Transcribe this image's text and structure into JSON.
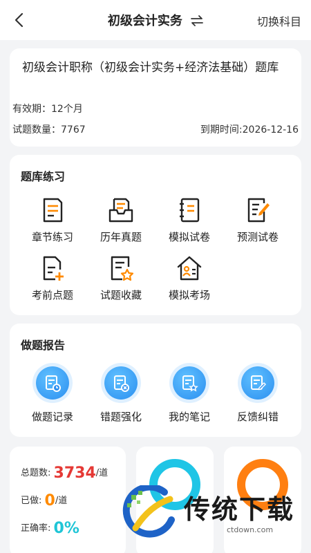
{
  "header": {
    "title": "初级会计实务",
    "switch_label": "切换科目",
    "icons": [
      "back-icon",
      "swap-icon"
    ]
  },
  "bank": {
    "title": "初级会计职称（初级会计实务+经济法基础）题库",
    "validity": "有效期：12个月",
    "question_count": "试题数量：7767",
    "expire": "到期时间:2026-12-16"
  },
  "practice": {
    "title": "题库练习",
    "items": [
      {
        "label": "章节练习",
        "icon": "chapter-icon"
      },
      {
        "label": "历年真题",
        "icon": "past-exam-icon"
      },
      {
        "label": "模拟试卷",
        "icon": "mock-paper-icon"
      },
      {
        "label": "预测试卷",
        "icon": "forecast-paper-icon"
      },
      {
        "label": "考前点题",
        "icon": "pre-exam-icon"
      },
      {
        "label": "试题收藏",
        "icon": "favorite-icon"
      },
      {
        "label": "模拟考场",
        "icon": "exam-room-icon"
      }
    ]
  },
  "report": {
    "title": "做题报告",
    "items": [
      {
        "label": "做题记录",
        "icon": "record-icon"
      },
      {
        "label": "错题强化",
        "icon": "wrong-question-icon"
      },
      {
        "label": "我的笔记",
        "icon": "notes-icon"
      },
      {
        "label": "反馈纠错",
        "icon": "feedback-icon"
      }
    ]
  },
  "stats": {
    "total_label": "总题数:",
    "total_value": "3734",
    "total_unit": "/道",
    "done_label": "已做:",
    "done_value": "0",
    "done_unit": "/道",
    "accuracy_label": "正确率:",
    "accuracy_value": "0%"
  },
  "watermark": {
    "text": "传统下载",
    "url": "ctdown.com"
  },
  "colors": {
    "accent_orange": "#ff8a00",
    "accent_blue": "#2c8ff0",
    "stat_red": "#e53935",
    "stat_cyan": "#1fc5d6"
  }
}
